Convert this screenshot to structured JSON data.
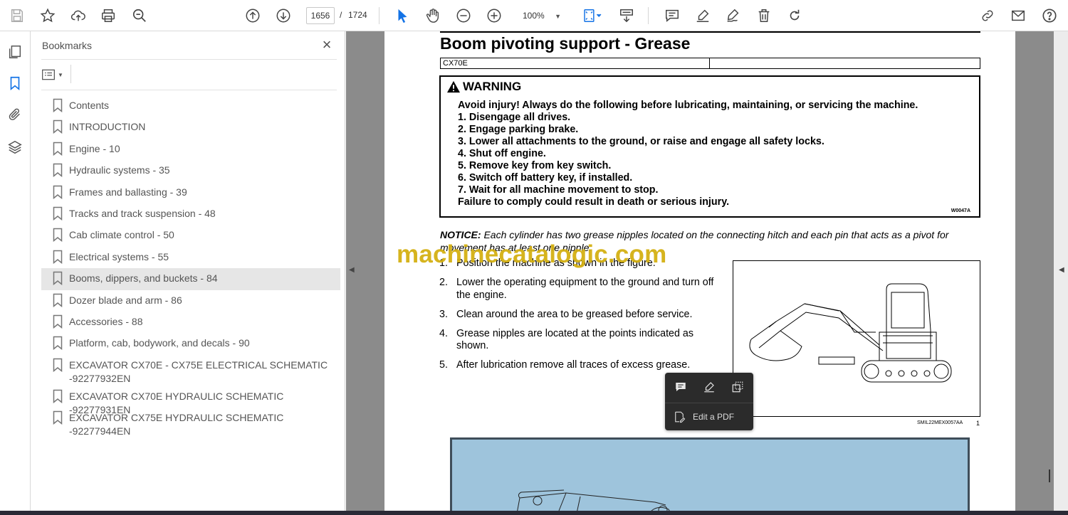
{
  "toolbar": {
    "page_current": "1656",
    "page_separator": "/",
    "page_total": "1724",
    "zoom": "100%"
  },
  "bookmarks": {
    "title": "Bookmarks",
    "items": [
      {
        "label": "Contents"
      },
      {
        "label": "INTRODUCTION"
      },
      {
        "label": "Engine - 10"
      },
      {
        "label": "Hydraulic systems - 35"
      },
      {
        "label": "Frames and ballasting - 39"
      },
      {
        "label": "Tracks and track suspension - 48"
      },
      {
        "label": "Cab climate control - 50"
      },
      {
        "label": "Electrical systems - 55"
      },
      {
        "label": "Booms, dippers, and buckets - 84"
      },
      {
        "label": "Dozer blade and arm - 86"
      },
      {
        "label": "Accessories - 88"
      },
      {
        "label": "Platform, cab, bodywork, and decals - 90"
      },
      {
        "label": "EXCAVATOR CX70E - CX75E ELECTRICAL SCHEMATIC -92277932EN"
      },
      {
        "label": "EXCAVATOR CX70E HYDRAULIC SCHEMATIC -92277931EN"
      },
      {
        "label": "EXCAVATOR CX75E HYDRAULIC SCHEMATIC -92277944EN"
      }
    ],
    "selected_index": 8
  },
  "document": {
    "title": "Boom pivoting support - Grease",
    "model": "CX70E",
    "warning": {
      "heading": "WARNING",
      "lines": [
        "Avoid injury! Always do the following before lubricating, maintaining, or servicing the machine.",
        "1.  Disengage all drives.",
        "2.  Engage parking brake.",
        "3.  Lower all attachments to the ground, or raise and engage all safety locks.",
        "4.  Shut off engine.",
        "5.  Remove key from key switch.",
        "6.  Switch off battery key, if installed.",
        "7.  Wait for all machine movement to stop.",
        "Failure to comply could result in death or serious injury."
      ],
      "code": "W0047A"
    },
    "notice_label": "NOTICE:",
    "notice_text": "Each cylinder has two grease nipples located on the connecting hitch and each pin that acts as a pivot for movement has at least one nipple.",
    "steps": [
      {
        "num": "1.",
        "text": "Position the machine as shown in the figure."
      },
      {
        "num": "2.",
        "text": "Lower the operating equipment to the ground and turn off the engine."
      },
      {
        "num": "3.",
        "text": "Clean around the area to be greased before service."
      },
      {
        "num": "4.",
        "text": "Grease nipples are located at the points indicated as shown."
      },
      {
        "num": "5.",
        "text": "After lubrication remove all traces of excess grease."
      }
    ],
    "figure_code": "SMIL22MEX0057AA",
    "figure_number": "1",
    "watermark": "machinecatalogic.com"
  },
  "popup": {
    "edit_label": "Edit a PDF"
  }
}
